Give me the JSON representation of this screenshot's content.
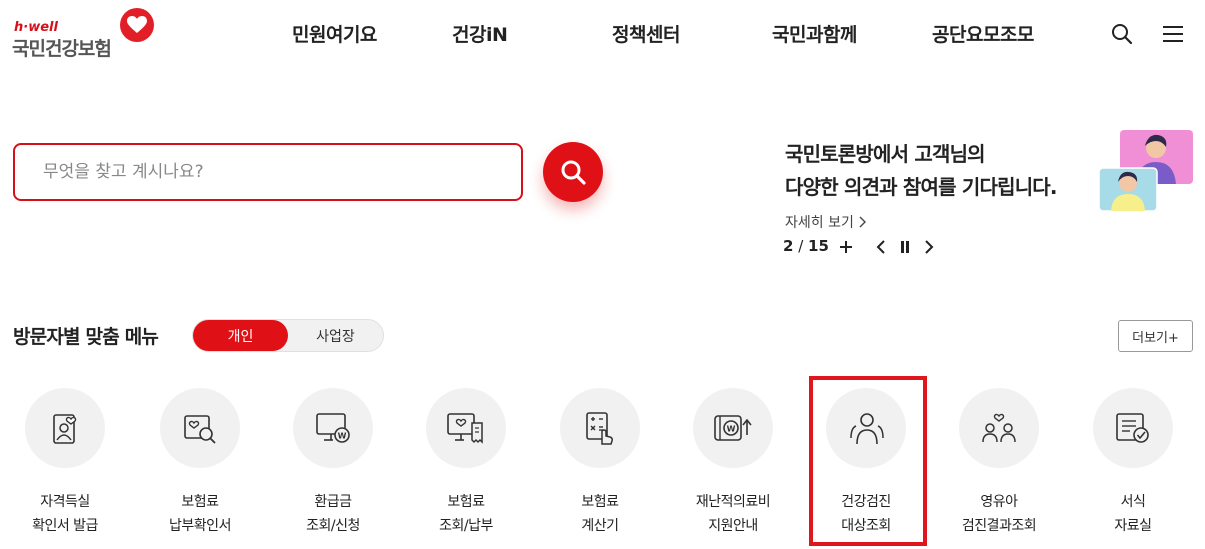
{
  "brand": {
    "tagline": "h·well",
    "name": "국민건강보험",
    "accent": "#e01116"
  },
  "nav": {
    "items": [
      "민원여기요",
      "건강iN",
      "정책센터",
      "국민과함께",
      "공단요모조모"
    ],
    "search_icon": "search-icon",
    "menu_icon": "hamburger-menu-icon"
  },
  "search": {
    "placeholder": "무엇을 찾고 계시나요?",
    "button_icon": "search-icon"
  },
  "banner": {
    "line1": "국민토론방에서 고객님의",
    "line2": "다양한 의견과 참여를 기다립니다.",
    "more": "자세히 보기",
    "current": "2",
    "total": "15"
  },
  "section": {
    "title": "방문자별 맞춤 메뉴",
    "tab_personal": "개인",
    "tab_business": "사업장",
    "more": "더보기+"
  },
  "menu": [
    {
      "line1": "자격득실",
      "line2": "확인서 발급",
      "icon": "id-card-icon"
    },
    {
      "line1": "보험료",
      "line2": "납부확인서",
      "icon": "document-search-icon"
    },
    {
      "line1": "환급금",
      "line2": "조회/신청",
      "icon": "monitor-refund-icon"
    },
    {
      "line1": "보험료",
      "line2": "조회/납부",
      "icon": "monitor-receipt-icon"
    },
    {
      "line1": "보험료",
      "line2": "계산기",
      "icon": "calculator-icon"
    },
    {
      "line1": "재난적의료비",
      "line2": "지원안내",
      "icon": "coin-support-icon"
    },
    {
      "line1": "건강검진",
      "line2": "대상조회",
      "icon": "people-group-icon"
    },
    {
      "line1": "영유아",
      "line2": "검진결과조회",
      "icon": "family-heart-icon"
    },
    {
      "line1": "서식",
      "line2": "자료실",
      "icon": "form-check-icon"
    }
  ]
}
